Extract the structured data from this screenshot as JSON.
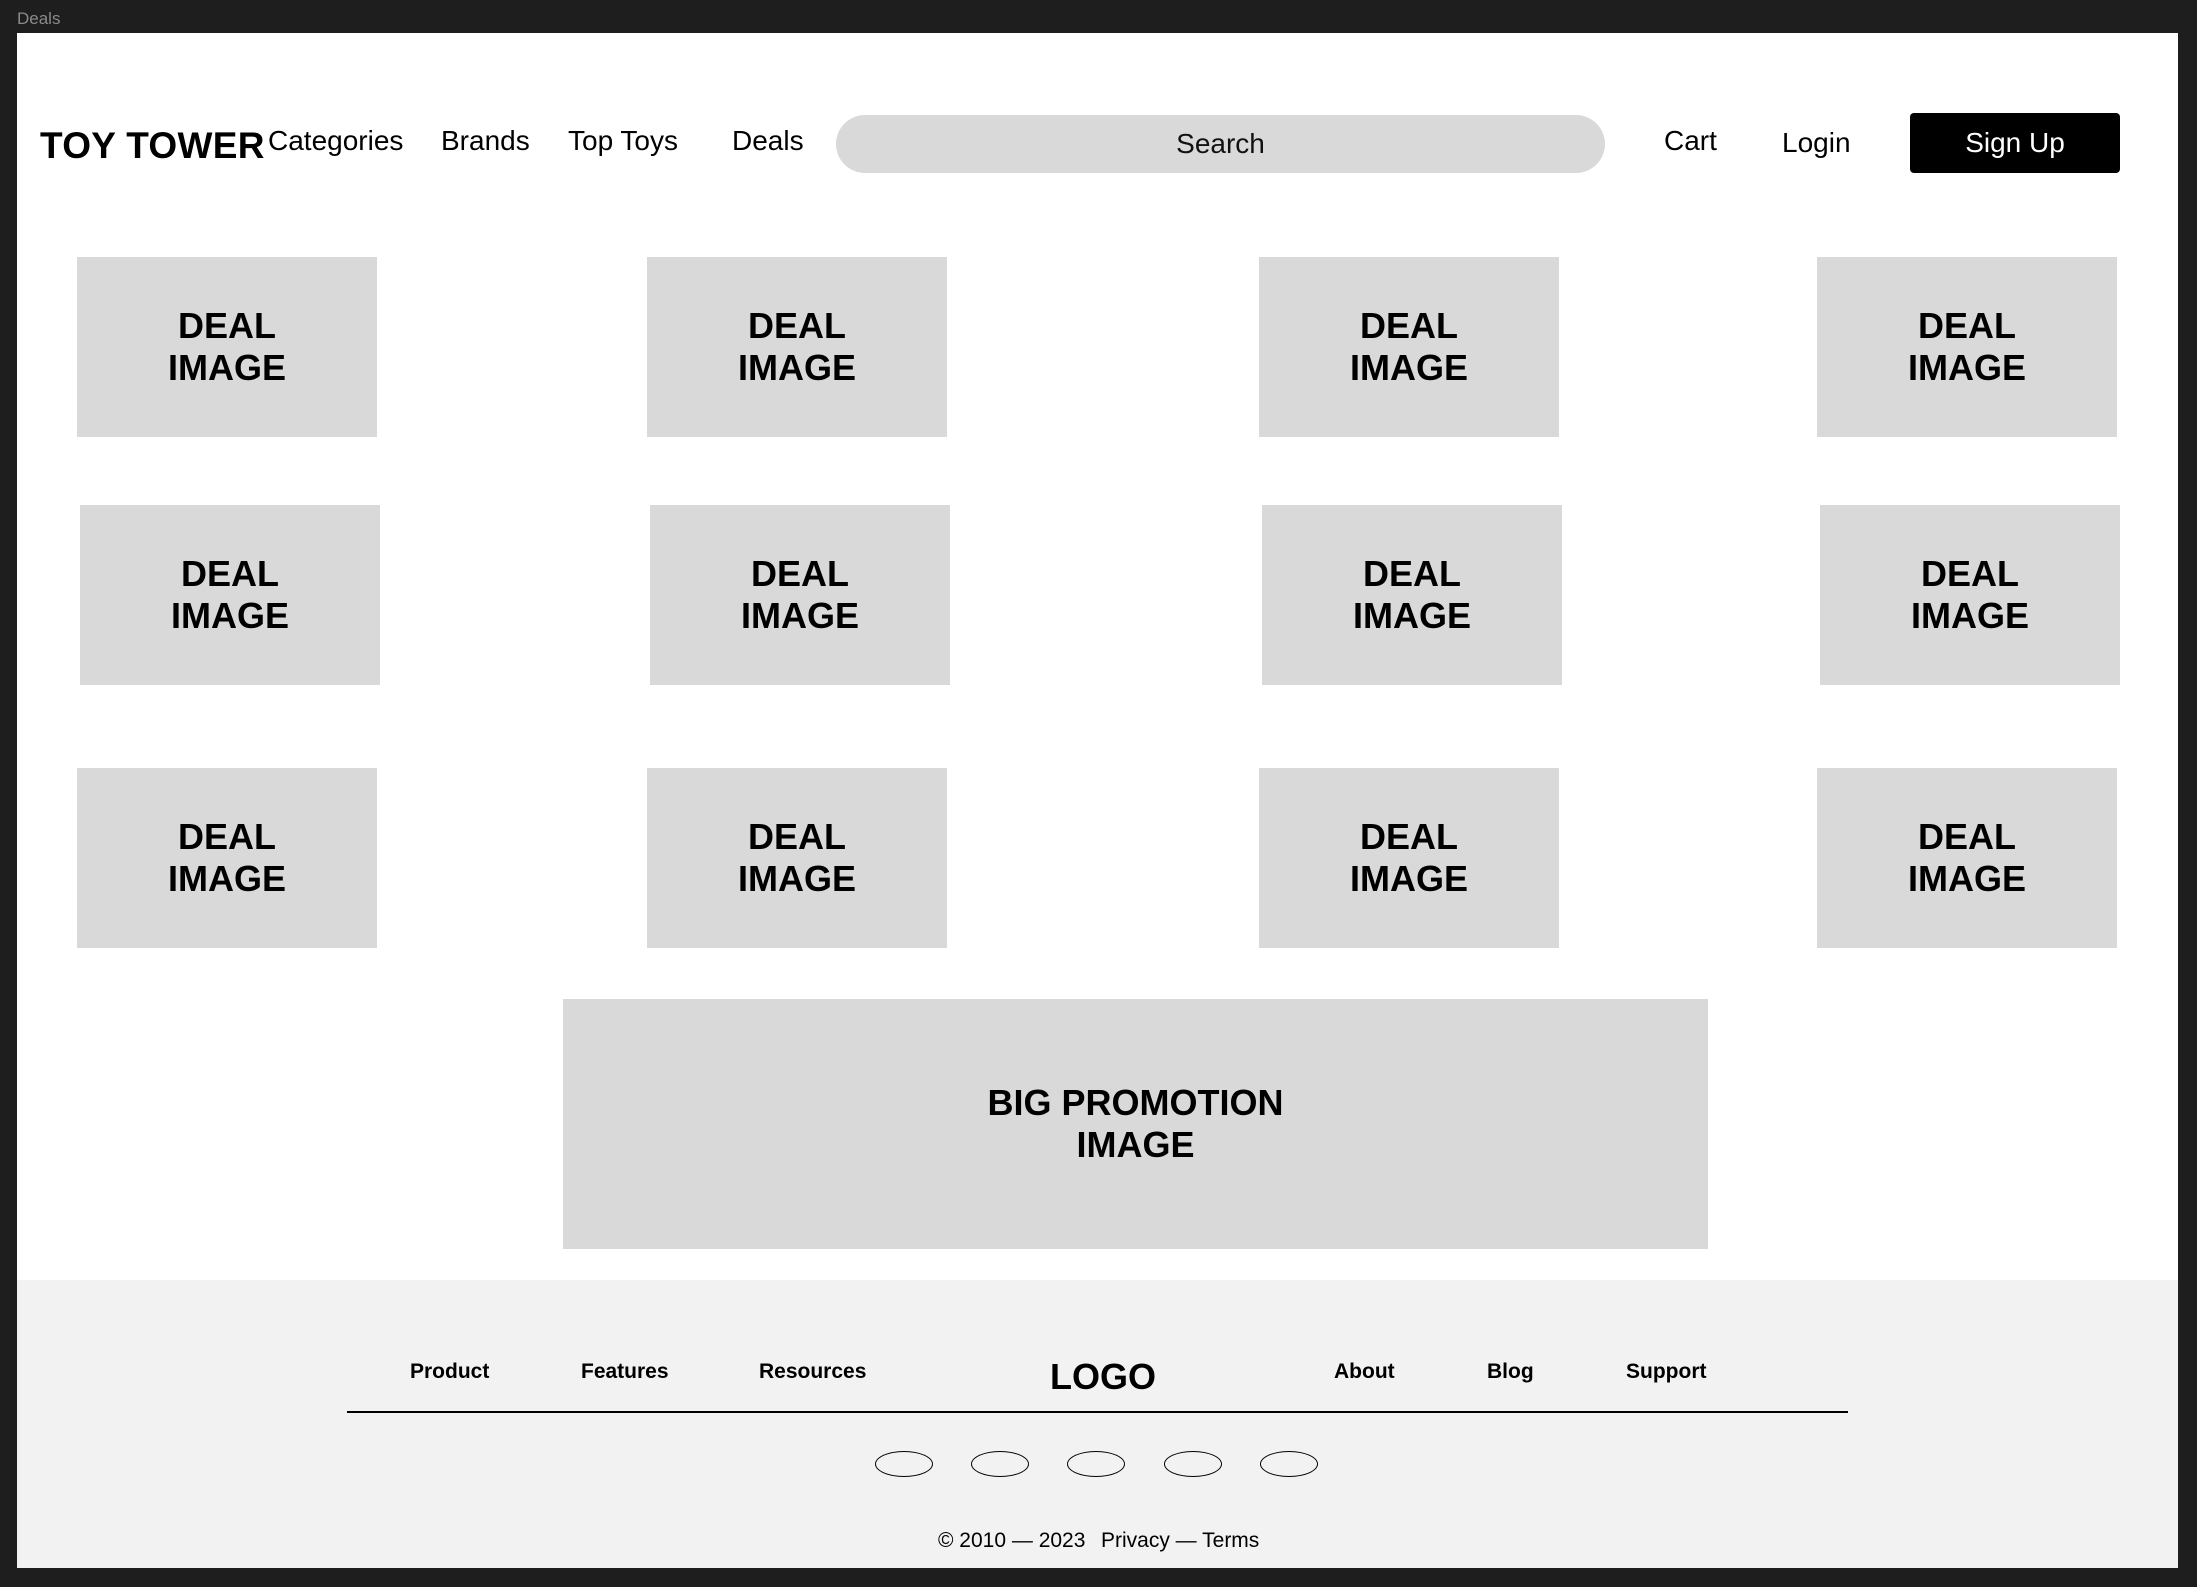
{
  "frame": {
    "label": "Deals"
  },
  "header": {
    "logo": "TOY TOWER",
    "nav": [
      "Categories",
      "Brands",
      "Top Toys",
      "Deals"
    ],
    "search": {
      "placeholder": "Search",
      "value": ""
    },
    "cart_label": "Cart",
    "login_label": "Login",
    "signup_label": "Sign Up"
  },
  "deals": {
    "items": [
      {
        "label": "DEAL IMAGE"
      },
      {
        "label": "DEAL IMAGE"
      },
      {
        "label": "DEAL IMAGE"
      },
      {
        "label": "DEAL IMAGE"
      },
      {
        "label": "DEAL IMAGE"
      },
      {
        "label": "DEAL IMAGE"
      },
      {
        "label": "DEAL IMAGE"
      },
      {
        "label": "DEAL IMAGE"
      },
      {
        "label": "DEAL IMAGE"
      },
      {
        "label": "DEAL IMAGE"
      },
      {
        "label": "DEAL IMAGE"
      },
      {
        "label": "DEAL IMAGE"
      }
    ]
  },
  "promo": {
    "label": "BIG PROMOTION IMAGE"
  },
  "footer": {
    "links_left": [
      "Product",
      "Features",
      "Resources"
    ],
    "logo": "LOGO",
    "links_right": [
      "About",
      "Blog",
      "Support"
    ],
    "social_icons": [
      "social-icon-1",
      "social-icon-2",
      "social-icon-3",
      "social-icon-4",
      "social-icon-5"
    ],
    "copyright": "© 2010 — 2023",
    "legal": "Privacy — Terms"
  },
  "colors": {
    "canvas": "#1e1e1e",
    "page": "#ffffff",
    "placeholder": "#d9d9d9",
    "footer_bg": "#f2f2f2",
    "primary_button": "#000000"
  }
}
